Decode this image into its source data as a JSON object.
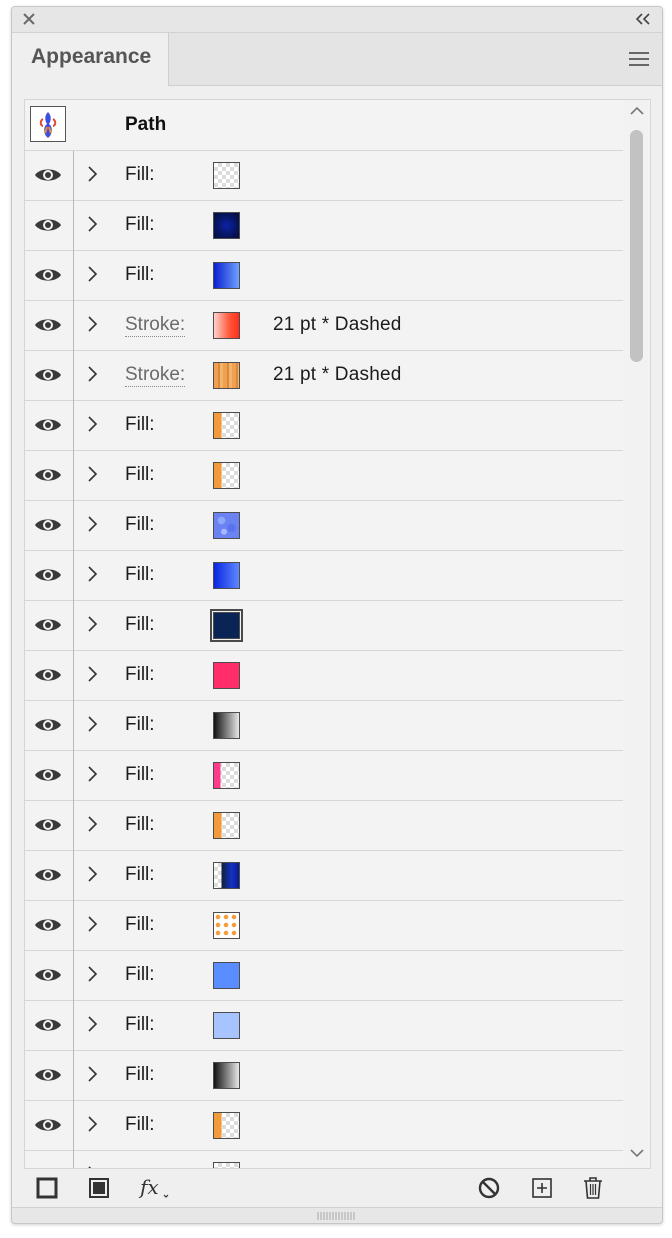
{
  "panel": {
    "tab_label": "Appearance",
    "header_title": "Path"
  },
  "rows": [
    {
      "label": "Fill:",
      "kind": "fill",
      "swatch": "checker",
      "value": ""
    },
    {
      "label": "Fill:",
      "kind": "fill",
      "swatch": "navy-radial",
      "value": ""
    },
    {
      "label": "Fill:",
      "kind": "fill",
      "swatch": "blue-grad",
      "value": ""
    },
    {
      "label": "Stroke:",
      "kind": "stroke",
      "swatch": "red-grad",
      "value": "21 pt * Dashed"
    },
    {
      "label": "Stroke:",
      "kind": "stroke",
      "swatch": "orange-stripe",
      "value": "21 pt * Dashed"
    },
    {
      "label": "Fill:",
      "kind": "fill",
      "swatch": "orange-checker",
      "value": ""
    },
    {
      "label": "Fill:",
      "kind": "fill",
      "swatch": "orange-checker",
      "value": ""
    },
    {
      "label": "Fill:",
      "kind": "fill",
      "swatch": "blue-noise",
      "value": ""
    },
    {
      "label": "Fill:",
      "kind": "fill",
      "swatch": "blue-grad2",
      "value": ""
    },
    {
      "label": "Fill:",
      "kind": "fill",
      "swatch": "dark-navy",
      "value": "",
      "selected": true
    },
    {
      "label": "Fill:",
      "kind": "fill",
      "swatch": "pink",
      "value": ""
    },
    {
      "label": "Fill:",
      "kind": "fill",
      "swatch": "black-grad",
      "value": ""
    },
    {
      "label": "Fill:",
      "kind": "fill",
      "swatch": "pink-checker",
      "value": ""
    },
    {
      "label": "Fill:",
      "kind": "fill",
      "swatch": "orange-checker",
      "value": ""
    },
    {
      "label": "Fill:",
      "kind": "fill",
      "swatch": "navy-checker",
      "value": ""
    },
    {
      "label": "Fill:",
      "kind": "fill",
      "swatch": "orange-dots",
      "value": ""
    },
    {
      "label": "Fill:",
      "kind": "fill",
      "swatch": "blue-solid",
      "value": ""
    },
    {
      "label": "Fill:",
      "kind": "fill",
      "swatch": "lightblue",
      "value": ""
    },
    {
      "label": "Fill:",
      "kind": "fill",
      "swatch": "black-grad",
      "value": ""
    },
    {
      "label": "Fill:",
      "kind": "fill",
      "swatch": "orange-checker",
      "value": ""
    },
    {
      "label": "",
      "kind": "fill",
      "swatch": "checker",
      "value": ""
    }
  ],
  "icons": {
    "close": "close-icon",
    "collapse": "collapse-panel-icon",
    "menu": "panel-menu-icon",
    "visibility": "eye-icon",
    "expand": "chevron-right-icon",
    "add_stroke": "add-new-stroke-icon",
    "add_fill": "add-new-fill-icon",
    "fx": "add-new-effect-icon",
    "clear": "clear-appearance-icon",
    "duplicate": "duplicate-item-icon",
    "delete": "delete-item-icon"
  },
  "colors": {
    "panel_bg": "#efefef",
    "row_border": "#d6d6d6",
    "scroll_thumb": "#c2c2c2"
  }
}
